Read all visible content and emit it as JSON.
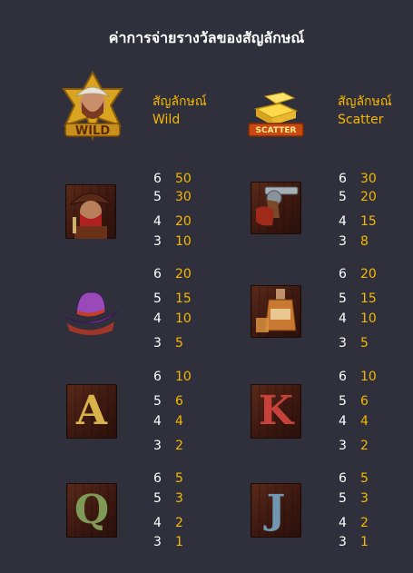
{
  "header": {
    "title": "ค่าการจ่ายรางวัลของสัญลักษณ์"
  },
  "special": {
    "wild": {
      "label": "สัญลักษณ์",
      "name": "Wild",
      "badge": "WILD",
      "icon": "sheriff-cowgirl-icon"
    },
    "scatter": {
      "label": "สัญลักษณ์",
      "name": "Scatter",
      "badge": "SCATTER",
      "icon": "gold-bars-icon"
    }
  },
  "symbols": [
    {
      "icon": "bandit-icon",
      "pays": [
        {
          "n": "6",
          "v": "50"
        },
        {
          "n": "5",
          "v": "30"
        },
        {
          "n": "4",
          "v": "20"
        },
        {
          "n": "3",
          "v": "10"
        }
      ]
    },
    {
      "icon": "revolver-icon",
      "pays": [
        {
          "n": "6",
          "v": "30"
        },
        {
          "n": "5",
          "v": "20"
        },
        {
          "n": "4",
          "v": "15"
        },
        {
          "n": "3",
          "v": "8"
        }
      ]
    },
    {
      "icon": "cowboy-hat-icon",
      "pays": [
        {
          "n": "6",
          "v": "20"
        },
        {
          "n": "5",
          "v": "15"
        },
        {
          "n": "4",
          "v": "10"
        },
        {
          "n": "3",
          "v": "5"
        }
      ]
    },
    {
      "icon": "whiskey-bottle-icon",
      "pays": [
        {
          "n": "6",
          "v": "20"
        },
        {
          "n": "5",
          "v": "15"
        },
        {
          "n": "4",
          "v": "10"
        },
        {
          "n": "3",
          "v": "5"
        }
      ]
    },
    {
      "letter": "A",
      "icon": "letter-a-icon",
      "color": "#d9b24a",
      "pays": [
        {
          "n": "6",
          "v": "10"
        },
        {
          "n": "5",
          "v": "6"
        },
        {
          "n": "4",
          "v": "4"
        },
        {
          "n": "3",
          "v": "2"
        }
      ]
    },
    {
      "letter": "K",
      "icon": "letter-k-icon",
      "color": "#c8423a",
      "pays": [
        {
          "n": "6",
          "v": "10"
        },
        {
          "n": "5",
          "v": "6"
        },
        {
          "n": "4",
          "v": "4"
        },
        {
          "n": "3",
          "v": "2"
        }
      ]
    },
    {
      "letter": "Q",
      "icon": "letter-q-icon",
      "color": "#7e9a56",
      "pays": [
        {
          "n": "6",
          "v": "5"
        },
        {
          "n": "5",
          "v": "3"
        },
        {
          "n": "4",
          "v": "2"
        },
        {
          "n": "3",
          "v": "1"
        }
      ]
    },
    {
      "letter": "J",
      "icon": "letter-j-icon",
      "color": "#6f98b0",
      "pays": [
        {
          "n": "6",
          "v": "5"
        },
        {
          "n": "5",
          "v": "3"
        },
        {
          "n": "4",
          "v": "2"
        },
        {
          "n": "3",
          "v": "1"
        }
      ]
    }
  ]
}
